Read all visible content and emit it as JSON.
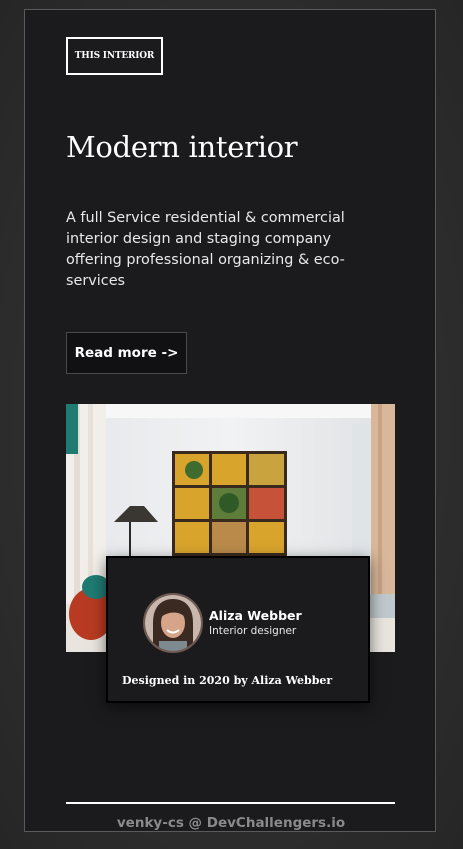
{
  "brand": {
    "label": "THIS INTERIOR"
  },
  "hero": {
    "title": "Modern interior",
    "description": "A full Service residential & commercial interior design and staging company offering professional organizing & eco-services",
    "cta_label": "Read more ->"
  },
  "designer": {
    "name": "Aliza Webber",
    "role": "Interior designer",
    "credit": "Designed in 2020 by Aliza Webber"
  },
  "footer": {
    "text": "venky-cs @ DevChallengers.io"
  },
  "colors": {
    "background": "#1b1b1d",
    "text": "#ffffff",
    "footer_text": "#8a8a8a"
  }
}
